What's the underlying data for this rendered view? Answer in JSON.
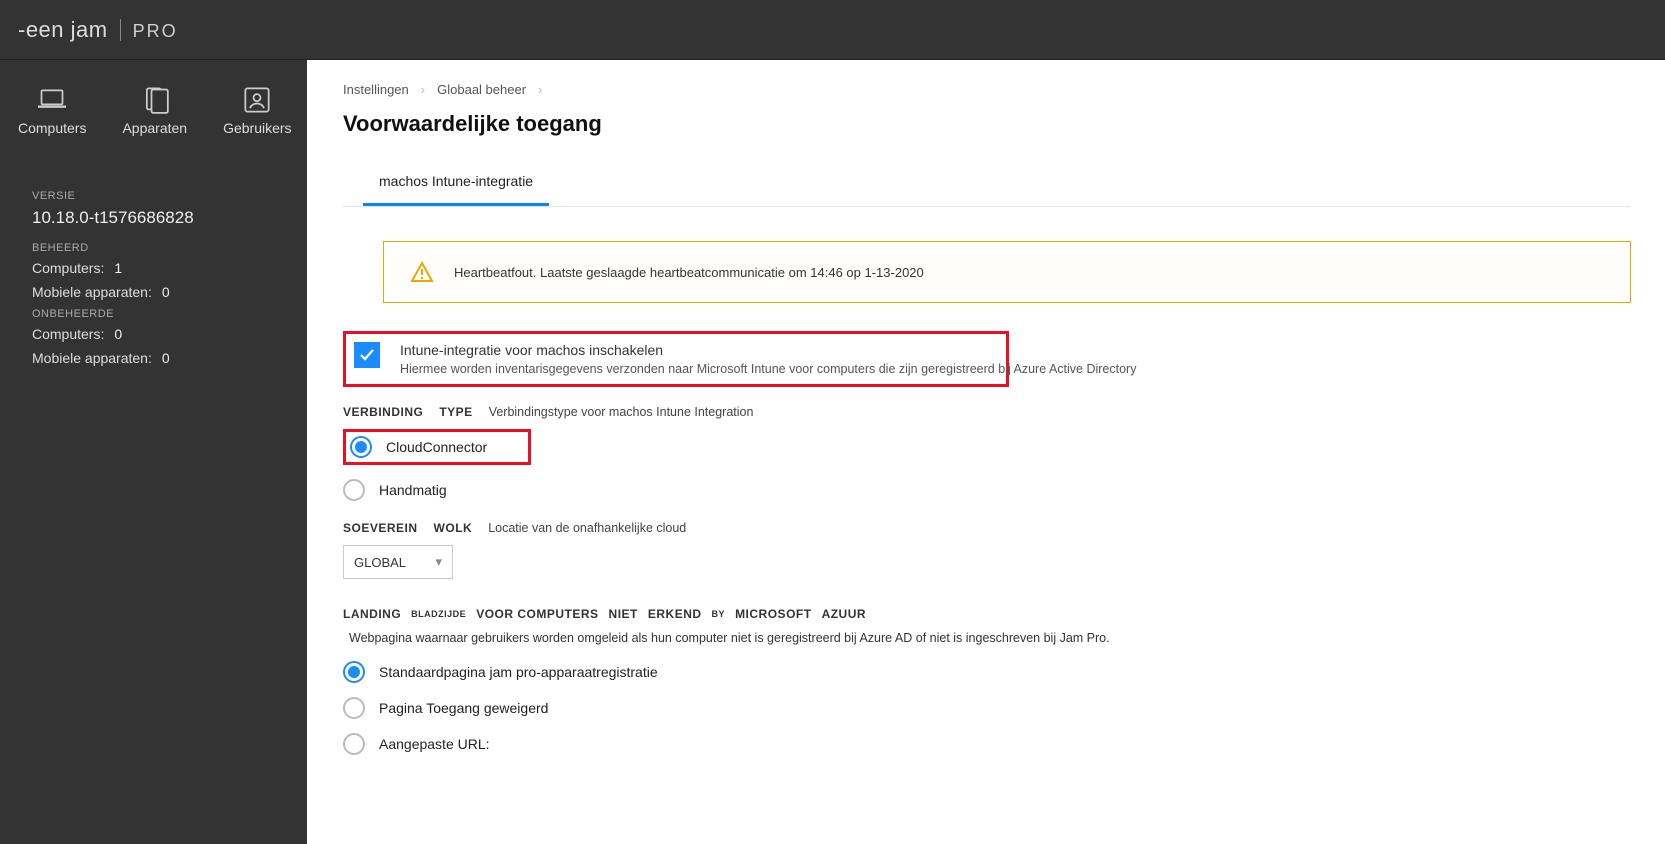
{
  "brand": {
    "name": "-een jam",
    "edition": "PRO"
  },
  "sidebar": {
    "nav": [
      {
        "label": "Computers"
      },
      {
        "label": "Apparaten"
      },
      {
        "label": "Gebruikers"
      }
    ],
    "version_label": "VERSIE",
    "version_value": "10.18.0-t1576686828",
    "managed_label": "BEHEERD",
    "managed": {
      "computers_key": "Computers:",
      "computers_val": "1",
      "mobile_key": "Mobiele apparaten:",
      "mobile_val": "0"
    },
    "unmanaged_label": "ONBEHEERDE",
    "unmanaged": {
      "computers_key": "Computers:",
      "computers_val": "0",
      "mobile_key": "Mobiele apparaten:",
      "mobile_val": "0"
    }
  },
  "breadcrumb": {
    "c1": "Instellingen",
    "c2": "Globaal beheer"
  },
  "page_title": "Voorwaardelijke toegang",
  "tab_label": "machos Intune-integratie",
  "alert_msg": "Heartbeatfout. Laatste geslaagde heartbeatcommunicatie om 14:46 op 1-13-2020",
  "enable_check": {
    "title": "Intune-integratie voor machos inschakelen",
    "subtitle": "Hiermee worden inventarisgegevens verzonden naar Microsoft Intune voor computers die zijn geregistreerd bij Azure Active Directory"
  },
  "conn_label": {
    "w1": "VERBINDING",
    "w2": "TYPE",
    "hint": "Verbindingstype voor machos Intune Integration"
  },
  "conn_options": {
    "o1": "CloudConnector",
    "o2": "Handmatig"
  },
  "sovereign_label": {
    "w1": "SOEVEREIN",
    "w2": "WOLK",
    "hint": "Locatie van de onafhankelijke cloud"
  },
  "sovereign_value": "GLOBAL",
  "landing_label": {
    "w1": "LANDING",
    "w2": "BLADZIJDE",
    "w3": "VOOR COMPUTERS",
    "w4": "NIET",
    "w5": "ERKEND",
    "w6": "BY",
    "w7": "MICROSOFT",
    "w8": "AZUUR",
    "desc": "Webpagina waarnaar gebruikers worden omgeleid als hun computer niet is geregistreerd bij Azure AD of niet is ingeschreven bij Jam Pro."
  },
  "landing_options": {
    "o1": "Standaardpagina jam pro-apparaatregistratie",
    "o2": "Pagina Toegang geweigerd",
    "o3": "Aangepaste URL:"
  }
}
